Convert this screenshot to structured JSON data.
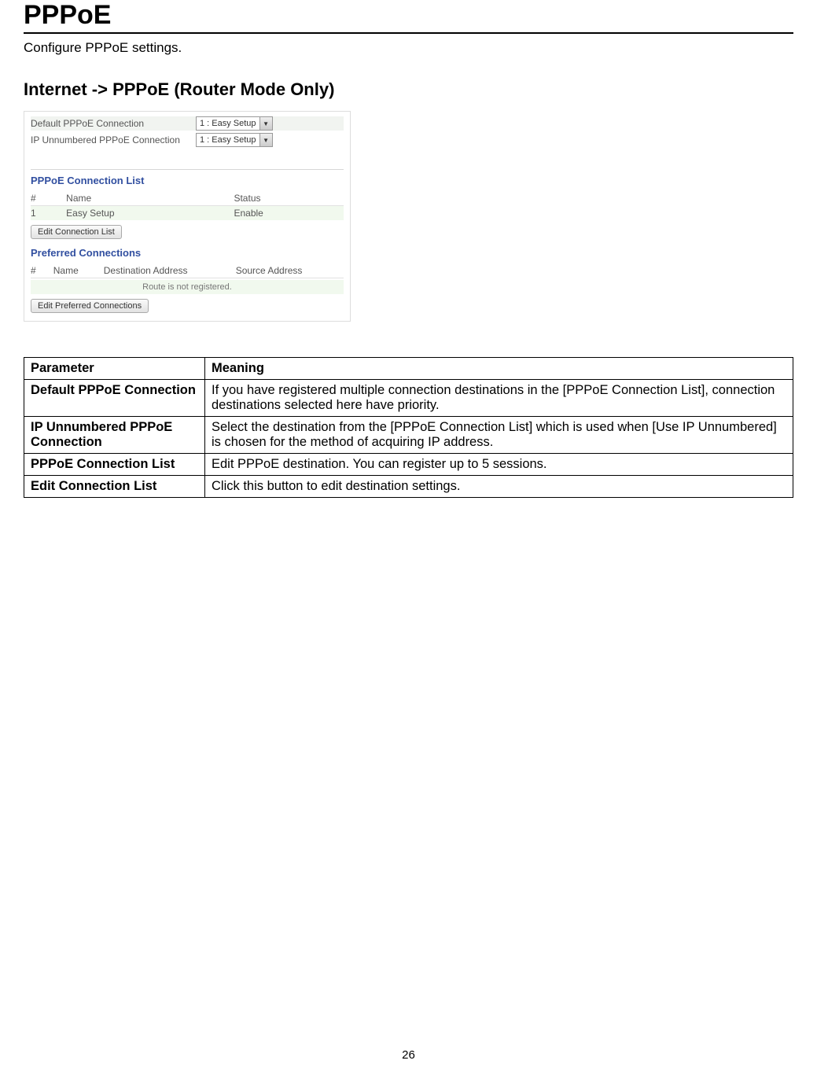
{
  "page": {
    "title": "PPPoE",
    "subtitle": "Configure PPPoE settings.",
    "section_heading": "Internet -> PPPoE (Router Mode Only)",
    "number": "26"
  },
  "screenshot": {
    "settings": {
      "default_label": "Default PPPoE Connection",
      "default_value": "1 : Easy Setup",
      "ipun_label": "IP Unnumbered PPPoE Connection",
      "ipun_value": "1 : Easy Setup"
    },
    "conn_list": {
      "title": "PPPoE Connection List",
      "col_num": "#",
      "col_name": "Name",
      "col_status": "Status",
      "row1_num": "1",
      "row1_name": "Easy Setup",
      "row1_status": "Enable",
      "button": "Edit Connection List"
    },
    "pref": {
      "title": "Preferred Connections",
      "col_num": "#",
      "col_name": "Name",
      "col_dest": "Destination Address",
      "col_src": "Source Address",
      "noroute": "Route is not registered.",
      "button": "Edit Preferred Connections"
    }
  },
  "table": {
    "head_param": "Parameter",
    "head_meaning": "Meaning",
    "rows": {
      "r1p": "Default PPPoE Connection",
      "r1m": "If you have registered multiple connection destinations in the [PPPoE Connection List], connection destinations selected here have priority.",
      "r2p": "IP Unnumbered PPPoE Connection",
      "r2m": "Select the destination from the [PPPoE Connection List] which is used when [Use IP Unnumbered] is chosen for the method of acquiring IP address.",
      "r3p": "PPPoE Connection List",
      "r3m": "Edit PPPoE destination. You can register up to 5 sessions.",
      "r4p": "Edit Connection List",
      "r4m": "Click this button to edit destination settings."
    }
  }
}
